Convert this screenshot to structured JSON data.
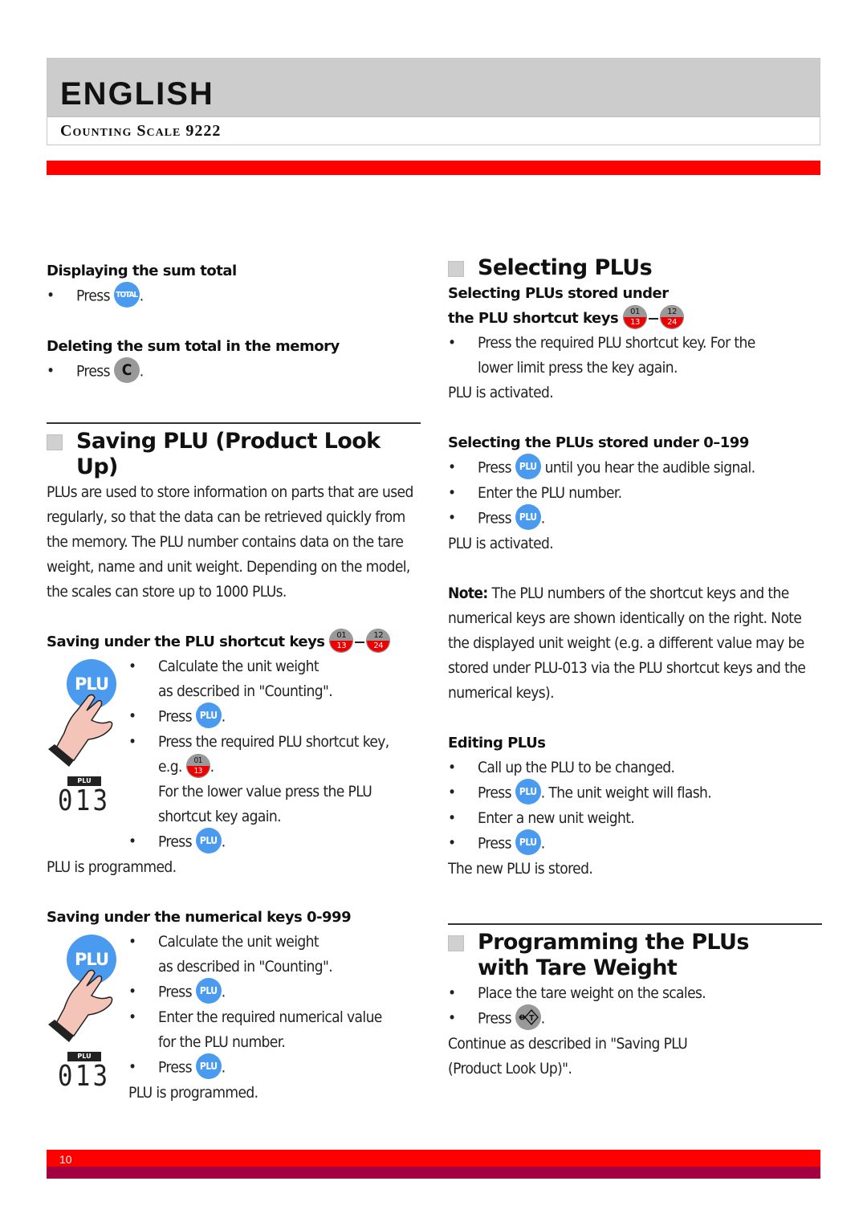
{
  "header": {
    "language": "ENGLISH",
    "product": "Counting Scale 9222"
  },
  "colors": {
    "accent_red": "#ff0000",
    "footer_dark": "#a30041",
    "header_gray": "#cccccc",
    "plu_key_blue": "#4a9bf0",
    "gray_key": "#999999"
  },
  "keys": {
    "plu": "PLU",
    "total": "TOTAL",
    "c": "C",
    "tare_icon": "tare-key-icon",
    "shortcut_first": {
      "upper": "01",
      "lower": "13"
    },
    "shortcut_last": {
      "upper": "12",
      "lower": "24"
    }
  },
  "left": {
    "sum_display": {
      "heading": "Displaying the sum total",
      "press": "Press",
      "end": "."
    },
    "sum_delete": {
      "heading": "Deleting the sum total in the memory",
      "press": "Press",
      "end": "."
    },
    "saving": {
      "title": "Saving PLU (Product Look Up)",
      "intro": "PLUs are used to store information on parts that are used regularly, so that the data can be retrieved quickly from the memory. The PLU number contains data on the tare weight, name and unit weight. Depending on the model, the scales can store up to 1000 PLUs."
    },
    "shortcut": {
      "heading": "Saving under the PLU shortcut keys",
      "step1a": "Calculate the unit weight",
      "step1b": "as described in \"Counting\".",
      "press": "Press",
      "step3": "Press the required PLU shortcut key,",
      "eg": "e.g.",
      "lower1": "For the lower value press the PLU",
      "lower2": "shortcut key again.",
      "result": "PLU is programmed.",
      "display_label": "PLU",
      "display_value": "013"
    },
    "numerical": {
      "heading": "Saving under the numerical keys 0-999",
      "step1a": "Calculate the unit weight",
      "step1b": "as described in \"Counting\".",
      "press": "Press",
      "step3a": "Enter the required numerical value",
      "step3b": "for the PLU number.",
      "result": "PLU is programmed.",
      "display_label": "PLU",
      "display_value": "013"
    }
  },
  "right": {
    "selecting": {
      "title": "Selecting PLUs",
      "sub1a": "Selecting PLUs stored under",
      "sub1b": "the PLU shortcut keys",
      "step1a": "Press the required PLU shortcut key. For the",
      "step1b": "lower limit press the key again.",
      "result1": "PLU is activated.",
      "sub2": "Selecting the PLUs stored under 0–199",
      "press": "Press",
      "step2a_rest": "until you hear the audible signal.",
      "step2b": "Enter the PLU number.",
      "result2": "PLU is activated.",
      "note_label": "Note:",
      "note_text": "The PLU numbers of the shortcut keys and the numerical keys are shown identically on the right. Note the displayed unit weight (e.g. a different value may be stored under PLU-013 via the PLU shortcut keys and the numerical keys)."
    },
    "editing": {
      "heading": "Editing PLUs",
      "step1": "Call up the PLU to be changed.",
      "press": "Press",
      "step2_rest": ". The unit weight will flash.",
      "step3": "Enter a new unit weight.",
      "result": "The new PLU is stored."
    },
    "tare": {
      "title_line1": "Programming the PLUs",
      "title_line2": "with Tare Weight",
      "step1": "Place the tare weight on the scales.",
      "press": "Press",
      "cont1": "Continue as described in \"Saving PLU",
      "cont2": "(Product Look Up)\"."
    }
  },
  "footer": {
    "page_number": "10"
  }
}
